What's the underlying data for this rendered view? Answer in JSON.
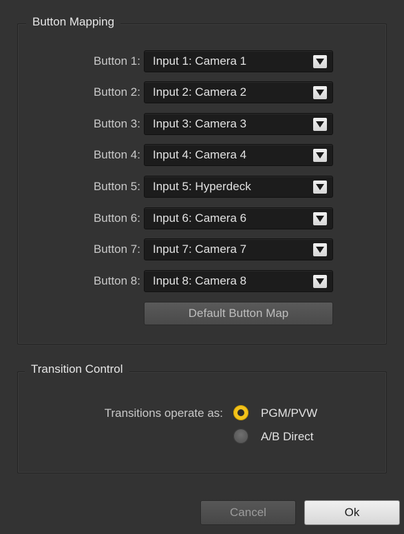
{
  "button_mapping": {
    "title": "Button Mapping",
    "rows": [
      {
        "label": "Button 1:",
        "value": "Input 1: Camera 1"
      },
      {
        "label": "Button 2:",
        "value": "Input 2: Camera 2"
      },
      {
        "label": "Button 3:",
        "value": "Input 3: Camera 3"
      },
      {
        "label": "Button 4:",
        "value": "Input 4: Camera 4"
      },
      {
        "label": "Button 5:",
        "value": "Input 5: Hyperdeck"
      },
      {
        "label": "Button 6:",
        "value": "Input 6: Camera 6"
      },
      {
        "label": "Button 7:",
        "value": "Input 7: Camera 7"
      },
      {
        "label": "Button 8:",
        "value": "Input 8: Camera 8"
      }
    ],
    "default_button_label": "Default Button Map"
  },
  "transition_control": {
    "title": "Transition Control",
    "label": "Transitions operate as:",
    "options": [
      {
        "label": "PGM/PVW",
        "selected": true
      },
      {
        "label": "A/B Direct",
        "selected": false
      }
    ]
  },
  "footer": {
    "cancel_label": "Cancel",
    "ok_label": "Ok"
  },
  "colors": {
    "background": "#333333",
    "accent_radio": "#f2c21b"
  },
  "icons": {
    "dropdown": "chevron-down-icon"
  }
}
